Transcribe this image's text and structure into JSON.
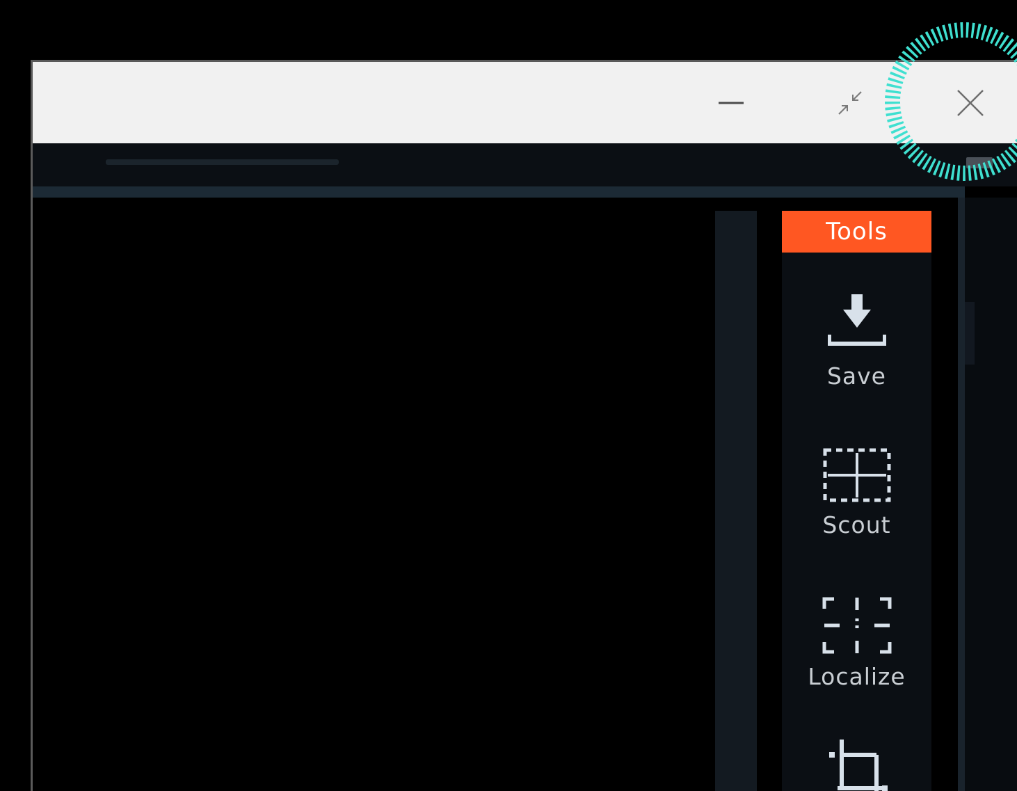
{
  "window": {
    "title_bar": {
      "minimize_icon": "minimize-icon",
      "restore_icon": "restore-icon",
      "close_icon": "close-icon"
    }
  },
  "tools_panel": {
    "header": "Tools",
    "items": [
      {
        "label": "Save",
        "icon": "save-icon"
      },
      {
        "label": "Scout",
        "icon": "scout-icon"
      },
      {
        "label": "Localize",
        "icon": "localize-icon"
      },
      {
        "label": "",
        "icon": "crop-icon"
      }
    ]
  },
  "colors": {
    "accent": "#ff5722",
    "highlight_ring": "#3fe0d0",
    "titlebar_bg": "#f1f1f1",
    "panel_bg": "#0b0f14"
  }
}
